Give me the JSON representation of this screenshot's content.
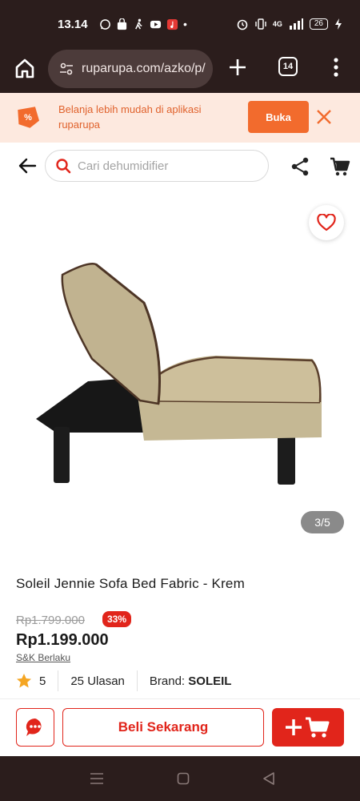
{
  "status": {
    "time": "13.14",
    "battery": "26",
    "network": "4G"
  },
  "browser": {
    "url": "ruparupa.com/azko/p/",
    "tab_count": "14"
  },
  "app_banner": {
    "text": "Belanja lebih mudah di aplikasi ruparupa",
    "open_label": "Buka"
  },
  "search": {
    "placeholder": "Cari dehumidifier"
  },
  "gallery": {
    "counter": "3/5"
  },
  "product": {
    "title": "Soleil Jennie Sofa Bed Fabric - Krem",
    "original_price": "Rp1.799.000",
    "discount": "33%",
    "price": "Rp1.199.000",
    "terms": "S&K Berlaku",
    "rating": "5",
    "reviews": "25 Ulasan",
    "brand_label": "Brand:",
    "brand": "SOLEIL"
  },
  "actions": {
    "buy_now": "Beli Sekarang"
  },
  "colors": {
    "accent_red": "#e1251b",
    "banner_orange": "#f26b2d",
    "chrome_dark": "#2b1d1c"
  }
}
